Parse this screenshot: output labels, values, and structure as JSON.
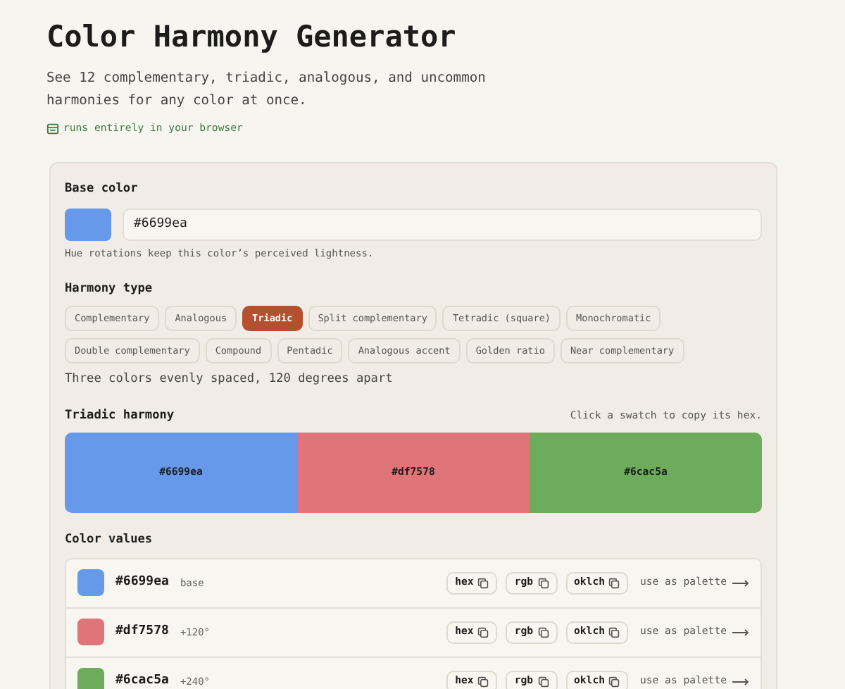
{
  "title": "Color Harmony Generator",
  "subtitle": "See 12 complementary, triadic, analogous, and uncommon harmonies for any color at once.",
  "badge": "runs entirely in your browser",
  "base": {
    "label": "Base color",
    "color": "#6699ea",
    "value": "#6699ea",
    "hint": "Hue rotations keep this color’s perceived lightness."
  },
  "harmony_type": {
    "label": "Harmony type",
    "options": [
      {
        "label": "Complementary",
        "selected": false
      },
      {
        "label": "Analogous",
        "selected": false
      },
      {
        "label": "Triadic",
        "selected": true
      },
      {
        "label": "Split complementary",
        "selected": false
      },
      {
        "label": "Tetradic (square)",
        "selected": false
      },
      {
        "label": "Monochromatic",
        "selected": false
      },
      {
        "label": "Double complementary",
        "selected": false
      },
      {
        "label": "Compound",
        "selected": false
      },
      {
        "label": "Pentadic",
        "selected": false
      },
      {
        "label": "Analogous accent",
        "selected": false
      },
      {
        "label": "Golden ratio",
        "selected": false
      },
      {
        "label": "Near complementary",
        "selected": false
      }
    ],
    "description": "Three colors evenly spaced, 120 degrees apart"
  },
  "harmony": {
    "title": "Triadic harmony",
    "hint": "Click a swatch to copy its hex.",
    "swatches": [
      {
        "label": "#6699ea",
        "color": "#6699ea"
      },
      {
        "label": "#df7578",
        "color": "#df7578"
      },
      {
        "label": "#6cac5a",
        "color": "#6cac5a"
      }
    ]
  },
  "values": {
    "title": "Color values",
    "rows": [
      {
        "hex": "#6699ea",
        "note": "base",
        "color": "#6699ea",
        "buttons": [
          "hex",
          "rgb",
          "oklch"
        ],
        "action": "use as palette"
      },
      {
        "hex": "#df7578",
        "note": "+120°",
        "color": "#df7578",
        "buttons": [
          "hex",
          "rgb",
          "oklch"
        ],
        "action": "use as palette"
      },
      {
        "hex": "#6cac5a",
        "note": "+240°",
        "color": "#6cac5a",
        "buttons": [
          "hex",
          "rgb",
          "oklch"
        ],
        "action": "use as palette"
      }
    ]
  }
}
